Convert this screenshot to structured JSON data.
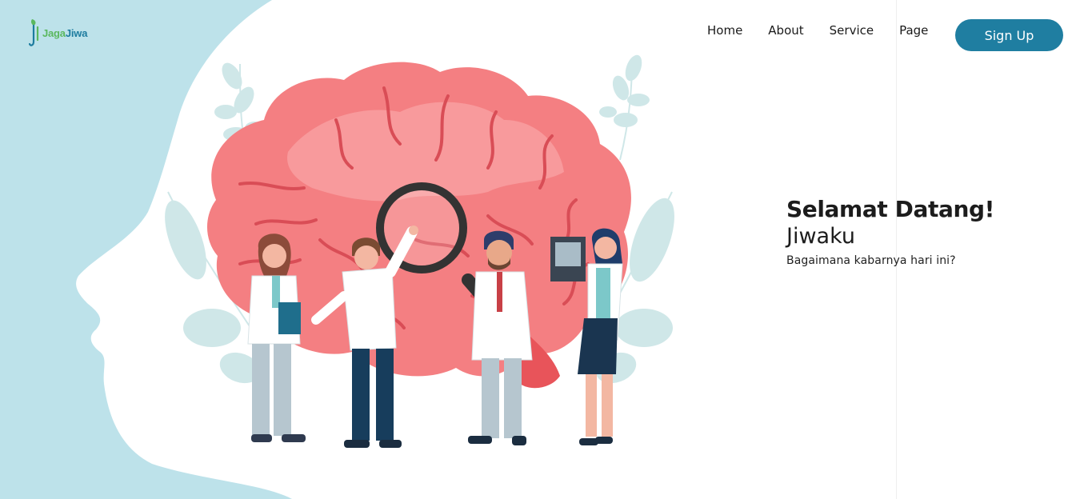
{
  "brand": {
    "name_part1": "Jaga",
    "name_part2": "Jiwa",
    "green": "#5bb85f",
    "blue": "#1d7c9f"
  },
  "nav": {
    "items": [
      {
        "label": "Home"
      },
      {
        "label": "About"
      },
      {
        "label": "Service"
      },
      {
        "label": "Page"
      }
    ],
    "signup_label": "Sign Up"
  },
  "hero": {
    "title": "Selamat Datang!",
    "subtitle": "Jiwaku",
    "question": "Bagaimana kabarnya hari ini?"
  },
  "illustration": {
    "subject": "brain-with-doctors",
    "face_silhouette_color": "#bde2ea",
    "brain_color": "#f47f82",
    "accent_color": "#1f7ea1"
  }
}
